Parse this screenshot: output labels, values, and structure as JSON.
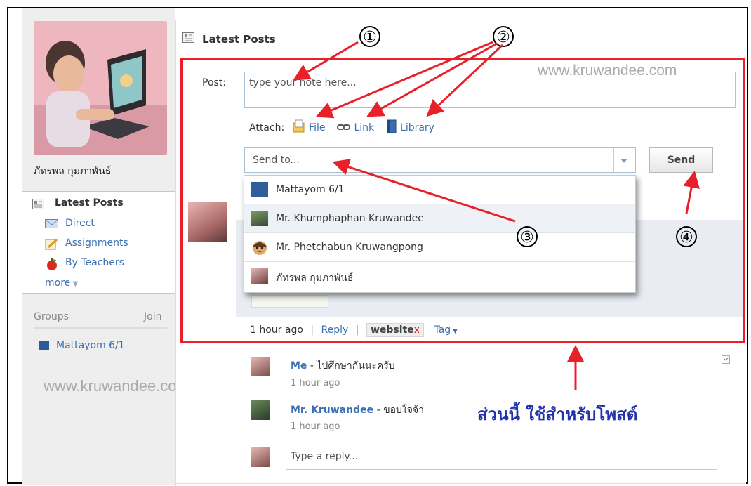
{
  "sidebar": {
    "user_name": "ภัทรพล กุมภาพันธ์",
    "nav": [
      {
        "label": "Latest Posts",
        "icon": "posts-icon"
      },
      {
        "label": "Direct",
        "icon": "envelope-icon"
      },
      {
        "label": "Assignments",
        "icon": "pencil-icon"
      },
      {
        "label": "By Teachers",
        "icon": "apple-icon"
      }
    ],
    "more_label": "more",
    "groups_label": "Groups",
    "join_label": "Join",
    "groups": [
      {
        "label": "Mattayom 6/1"
      }
    ],
    "watermark": "www.kruwandee.com"
  },
  "main": {
    "section_title": "Latest Posts",
    "watermark": "www.kruwandee.com",
    "post_label": "Post:",
    "post_placeholder": "type your note here...",
    "attach_label": "Attach:",
    "attach_file": "File",
    "attach_link": "Link",
    "attach_library": "Library",
    "sendto_placeholder": "Send to...",
    "send_button": "Send",
    "recipients": [
      {
        "label": "Mattayom 6/1",
        "icon": "group-icon"
      },
      {
        "label": "Mr. Khumphaphan Kruwandee",
        "icon": "teacher-avatar-icon"
      },
      {
        "label": "Mr. Phetchabun Kruwangpong",
        "icon": "cartoon-avatar-icon"
      },
      {
        "label": "ภัทรพล กุมภาพันธ์",
        "icon": "student-avatar-icon"
      }
    ],
    "post_meta": {
      "time": "1 hour ago",
      "reply": "Reply",
      "tag_website": "website",
      "tag_remove": "x",
      "tag_menu": "Tag"
    },
    "comments": [
      {
        "name": "Me",
        "text": " - ไปศึกษากันนะครับ",
        "time": "1 hour ago"
      },
      {
        "name": "Mr. Kruwandee",
        "text": " - ขอบใจจ้า",
        "time": "1 hour ago"
      }
    ],
    "reply_placeholder": "Type a reply..."
  },
  "annotations": {
    "numbers": [
      "①",
      "②",
      "③",
      "④"
    ],
    "caption": "ส่วนนี้ ใช้สำหรับโพสต์",
    "color": "#e8202a"
  }
}
